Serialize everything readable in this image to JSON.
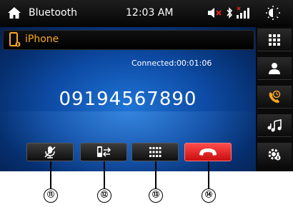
{
  "status_bar": {
    "title": "Bluetooth",
    "time": "12:03 AM",
    "icons": [
      "home-icon",
      "mute-icon",
      "bluetooth-icon",
      "signal-icon",
      "brightness-icon"
    ]
  },
  "device": {
    "name": "iPhone",
    "icon": "phone-icon"
  },
  "call": {
    "status": "Connected:00:01:06",
    "number": "09194567890"
  },
  "controls": [
    "mic-mute-icon",
    "transfer-to-phone-icon",
    "keypad-icon",
    "hang-up-icon"
  ],
  "sidebar": [
    "keypad-icon",
    "contacts-icon",
    "recent-calls-icon",
    "music-icon",
    "settings-icon"
  ],
  "callouts": [
    "⑪",
    "⑫",
    "⑬",
    "⑭"
  ],
  "colors": {
    "accent": "#f5a623",
    "end_call": "#e01b1b",
    "background": "#0d4aa3"
  }
}
